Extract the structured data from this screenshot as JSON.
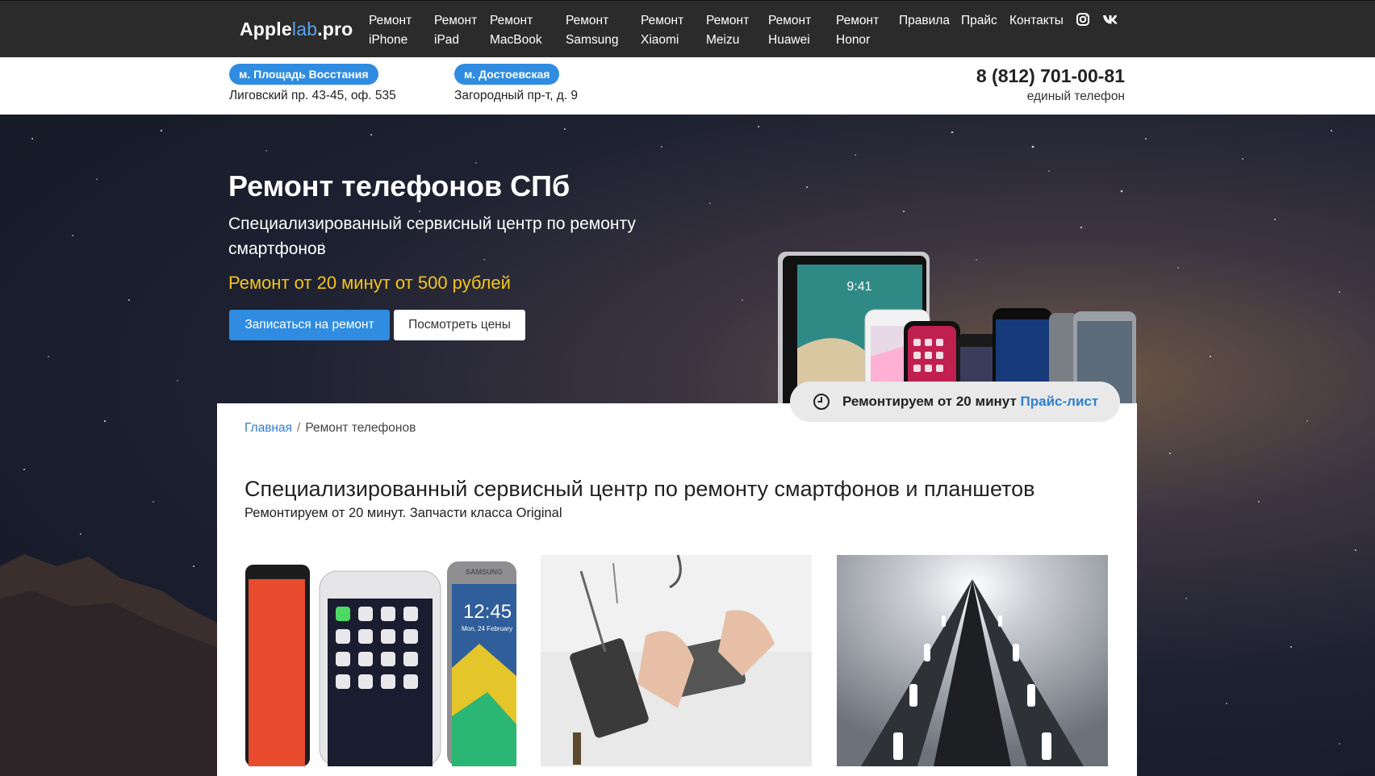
{
  "logo": {
    "part1": "Apple",
    "part2": "lab",
    "part3": ".pro"
  },
  "nav": [
    {
      "l1": "Ремонт",
      "l2": "iPhone"
    },
    {
      "l1": "Ремонт",
      "l2": "iPad"
    },
    {
      "l1": "Ремонт",
      "l2": "MacBook"
    },
    {
      "l1": "Ремонт",
      "l2": "Samsung"
    },
    {
      "l1": "Ремонт",
      "l2": "Xiaomi"
    },
    {
      "l1": "Ремонт",
      "l2": "Meizu"
    },
    {
      "l1": "Ремонт",
      "l2": "Huawei"
    },
    {
      "l1": "Ремонт",
      "l2": "Honor"
    }
  ],
  "nav_extra": [
    "Правила",
    "Прайс",
    "Контакты"
  ],
  "nav_icons": [
    "instagram-icon",
    "vk-icon"
  ],
  "locations": [
    {
      "metro": "м. Площадь Восстания",
      "address": "Лиговский пр. 43-45, оф. 535"
    },
    {
      "metro": "м. Достоевская",
      "address": "Загородный пр-т, д. 9"
    }
  ],
  "contact": {
    "phone": "8 (812) 701-00-81",
    "phone_label": "единый телефон"
  },
  "hero": {
    "title": "Ремонт телефонов СПб",
    "subtitle": "Специализированный сервисный центр по ремонту смартфонов",
    "promo": "Ремонт от 20 минут от 500 рублей",
    "primary_button": "Записаться на ремонт",
    "secondary_button": "Посмотреть цены",
    "device_time": "9:41"
  },
  "badge": {
    "text": "Ремонтируем от 20 минут",
    "link": "Прайс-лист"
  },
  "breadcrumb": {
    "home": "Главная",
    "separator": "/",
    "current": "Ремонт телефонов"
  },
  "section": {
    "title": "Специализированный сервисный центр по ремонту смартфонов и планшетов",
    "subtitle": "Ремонтируем от 20 минут. Запчасти класса Original"
  },
  "cards": [
    {
      "image": "smartphones-photo",
      "phone_time": "12:45",
      "phone_date": "Mon, 24 February",
      "brand": "SAMSUNG"
    },
    {
      "image": "repair-photo"
    },
    {
      "image": "metro-escalator-photo"
    }
  ],
  "colors": {
    "accent": "#2f8ce0",
    "promo": "#f5c518",
    "nav_bg": "#2b2b2b",
    "link": "#2f7fd1"
  }
}
